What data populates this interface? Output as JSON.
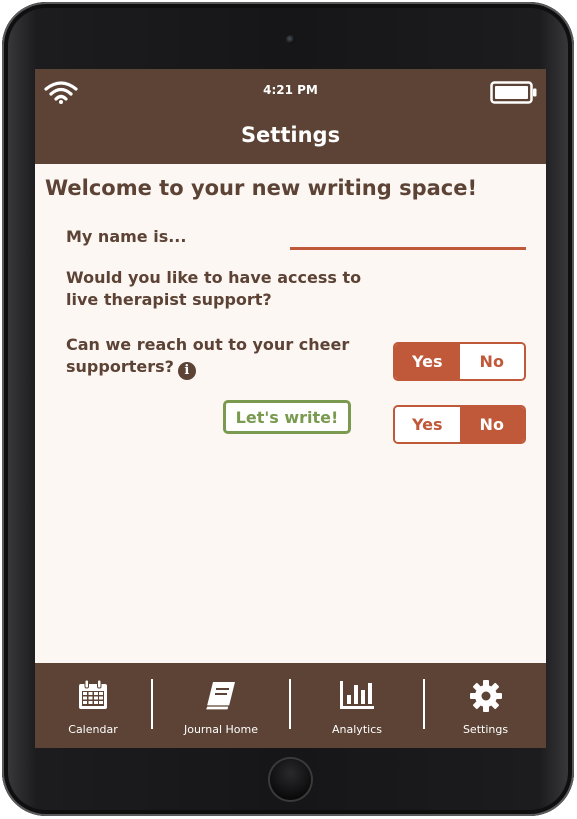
{
  "status_bar": {
    "time": "4:21 PM",
    "wifi_icon": "wifi-icon",
    "battery_icon": "battery-icon"
  },
  "header": {
    "title": "Settings"
  },
  "main": {
    "welcome": "Welcome to your new writing space!",
    "name_label": "My name is...",
    "name_value": "",
    "questions": [
      {
        "text": "Would you like to have access to live therapist support?",
        "options": [
          "Yes",
          "No"
        ],
        "selected": "Yes"
      },
      {
        "text": "Can we reach out to your cheer supporters?",
        "options": [
          "Yes",
          "No"
        ],
        "selected": "No",
        "info_glyph": "i"
      }
    ],
    "submit_label": "Let's write!"
  },
  "tabs": [
    {
      "label": "Calendar",
      "icon": "calendar-icon"
    },
    {
      "label": "Journal Home",
      "icon": "book-icon"
    },
    {
      "label": "Analytics",
      "icon": "bar-chart-icon"
    },
    {
      "label": "Settings",
      "icon": "gear-icon"
    }
  ],
  "colors": {
    "header_brown": "#5c4335",
    "accent_orange": "#c0583a",
    "accent_green": "#7a9a50",
    "background": "#fcf7f3"
  }
}
